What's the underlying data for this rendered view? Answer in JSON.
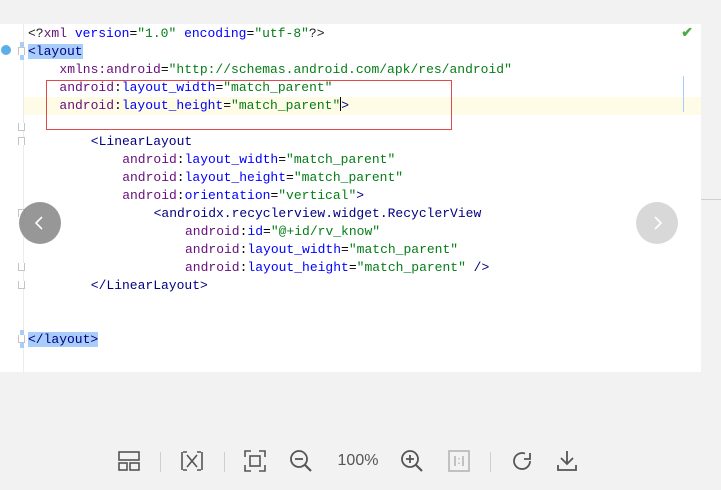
{
  "editor": {
    "lines": [
      {
        "text_parts": [
          [
            "<?",
            "pi"
          ],
          [
            "xml ",
            "ns"
          ],
          [
            "version",
            "attr"
          ],
          [
            "=",
            "plain"
          ],
          [
            "\"1.0\"",
            "val"
          ],
          [
            " ",
            "plain"
          ],
          [
            "encoding",
            "attr"
          ],
          [
            "=",
            "plain"
          ],
          [
            "\"utf-8\"",
            "val"
          ],
          [
            "?>",
            "pi"
          ]
        ],
        "indent": 0
      },
      {
        "text_parts": [
          [
            "<layout",
            "tag-hl"
          ]
        ],
        "indent": 0
      },
      {
        "text_parts": [
          [
            "xmlns:",
            "ns"
          ],
          [
            "android",
            "ns"
          ],
          [
            "=",
            "plain"
          ],
          [
            "\"http://schemas.android.com/apk/res/android\"",
            "val"
          ]
        ],
        "indent": 4
      },
      {
        "text_parts": [
          [
            "android",
            "ns"
          ],
          [
            ":",
            "plain"
          ],
          [
            "layout_width",
            "attr"
          ],
          [
            "=",
            "plain"
          ],
          [
            "\"match_parent\"",
            "val"
          ]
        ],
        "indent": 4
      },
      {
        "text_parts": [
          [
            "android",
            "ns"
          ],
          [
            ":",
            "plain"
          ],
          [
            "layout_height",
            "attr"
          ],
          [
            "=",
            "plain"
          ],
          [
            "\"match_parent\"",
            "val"
          ],
          [
            "CARET",
            "caret"
          ],
          [
            ">",
            "tag"
          ]
        ],
        "indent": 4
      },
      {
        "text_parts": [],
        "indent": 0
      },
      {
        "text_parts": [
          [
            "<LinearLayout",
            "tag"
          ]
        ],
        "indent": 8
      },
      {
        "text_parts": [
          [
            "android",
            "ns"
          ],
          [
            ":",
            "plain"
          ],
          [
            "layout_width",
            "attr"
          ],
          [
            "=",
            "plain"
          ],
          [
            "\"match_parent\"",
            "val"
          ]
        ],
        "indent": 12
      },
      {
        "text_parts": [
          [
            "android",
            "ns"
          ],
          [
            ":",
            "plain"
          ],
          [
            "layout_height",
            "attr"
          ],
          [
            "=",
            "plain"
          ],
          [
            "\"match_parent\"",
            "val"
          ]
        ],
        "indent": 12
      },
      {
        "text_parts": [
          [
            "android",
            "ns"
          ],
          [
            ":",
            "plain"
          ],
          [
            "orientation",
            "attr"
          ],
          [
            "=",
            "plain"
          ],
          [
            "\"vertical\"",
            "val"
          ],
          [
            ">",
            "tag"
          ]
        ],
        "indent": 12
      },
      {
        "text_parts": [
          [
            "<androidx.recyclerview.widget.RecyclerView",
            "tag"
          ]
        ],
        "indent": 16
      },
      {
        "text_parts": [
          [
            "android",
            "ns"
          ],
          [
            ":",
            "plain"
          ],
          [
            "id",
            "attr"
          ],
          [
            "=",
            "plain"
          ],
          [
            "\"@+id/rv_know\"",
            "val"
          ]
        ],
        "indent": 20
      },
      {
        "text_parts": [
          [
            "android",
            "ns"
          ],
          [
            ":",
            "plain"
          ],
          [
            "layout_width",
            "attr"
          ],
          [
            "=",
            "plain"
          ],
          [
            "\"match_parent\"",
            "val"
          ]
        ],
        "indent": 20
      },
      {
        "text_parts": [
          [
            "android",
            "ns"
          ],
          [
            ":",
            "plain"
          ],
          [
            "layout_height",
            "attr"
          ],
          [
            "=",
            "plain"
          ],
          [
            "\"match_parent\"",
            "val"
          ],
          [
            " />",
            "tag"
          ]
        ],
        "indent": 20
      },
      {
        "text_parts": [
          [
            "</LinearLayout>",
            "tag"
          ]
        ],
        "indent": 8
      },
      {
        "text_parts": [],
        "indent": 0
      },
      {
        "text_parts": [],
        "indent": 0
      },
      {
        "text_parts": [
          [
            "</layout>",
            "tag-hl"
          ]
        ],
        "indent": 0
      }
    ],
    "cursor_line": 4,
    "status_icon": "check-icon"
  },
  "navigation": {
    "prev_icon": "chevron-left-icon",
    "next_icon": "chevron-right-icon"
  },
  "toolbar": {
    "zoom_label": "100%",
    "buttons": [
      "layout-icon",
      "fit-width-icon",
      "fit-screen-icon",
      "zoom-out-icon",
      "zoom-in-icon",
      "actual-size-icon",
      "rotate-icon",
      "download-icon"
    ]
  },
  "colors": {
    "tag": "#000080",
    "namespace": "#660e7a",
    "attribute": "#0000ff",
    "value": "#067d17",
    "annotation_box": "#e04a4a"
  }
}
